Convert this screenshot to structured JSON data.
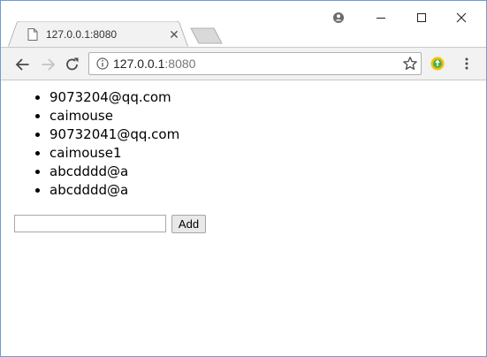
{
  "browser": {
    "tab_title": "127.0.0.1:8080",
    "close_glyph": "✕",
    "address": {
      "host": "127.0.0.1",
      "port": ":8080"
    }
  },
  "page": {
    "emails": [
      "9073204@qq.com",
      "caimouse",
      "90732041@qq.com",
      "caimouse1",
      "abcdddd@a",
      "abcdddd@a"
    ],
    "input_value": "",
    "add_label": "Add"
  },
  "colors": {
    "window_border": "#6e9bd6",
    "toolbar_bg": "#f2f2f2",
    "extension_accent": "#4caf50"
  },
  "icons": {
    "tab_favicon": "page-icon",
    "profile": "user-icon",
    "minimize": "minimize-icon",
    "maximize": "maximize-icon",
    "close": "close-icon",
    "back": "back-arrow-icon",
    "forward": "forward-arrow-icon",
    "reload": "reload-icon",
    "info": "info-icon",
    "bookmark": "star-icon",
    "extension": "extension-icon",
    "menu": "menu-dots-icon"
  }
}
